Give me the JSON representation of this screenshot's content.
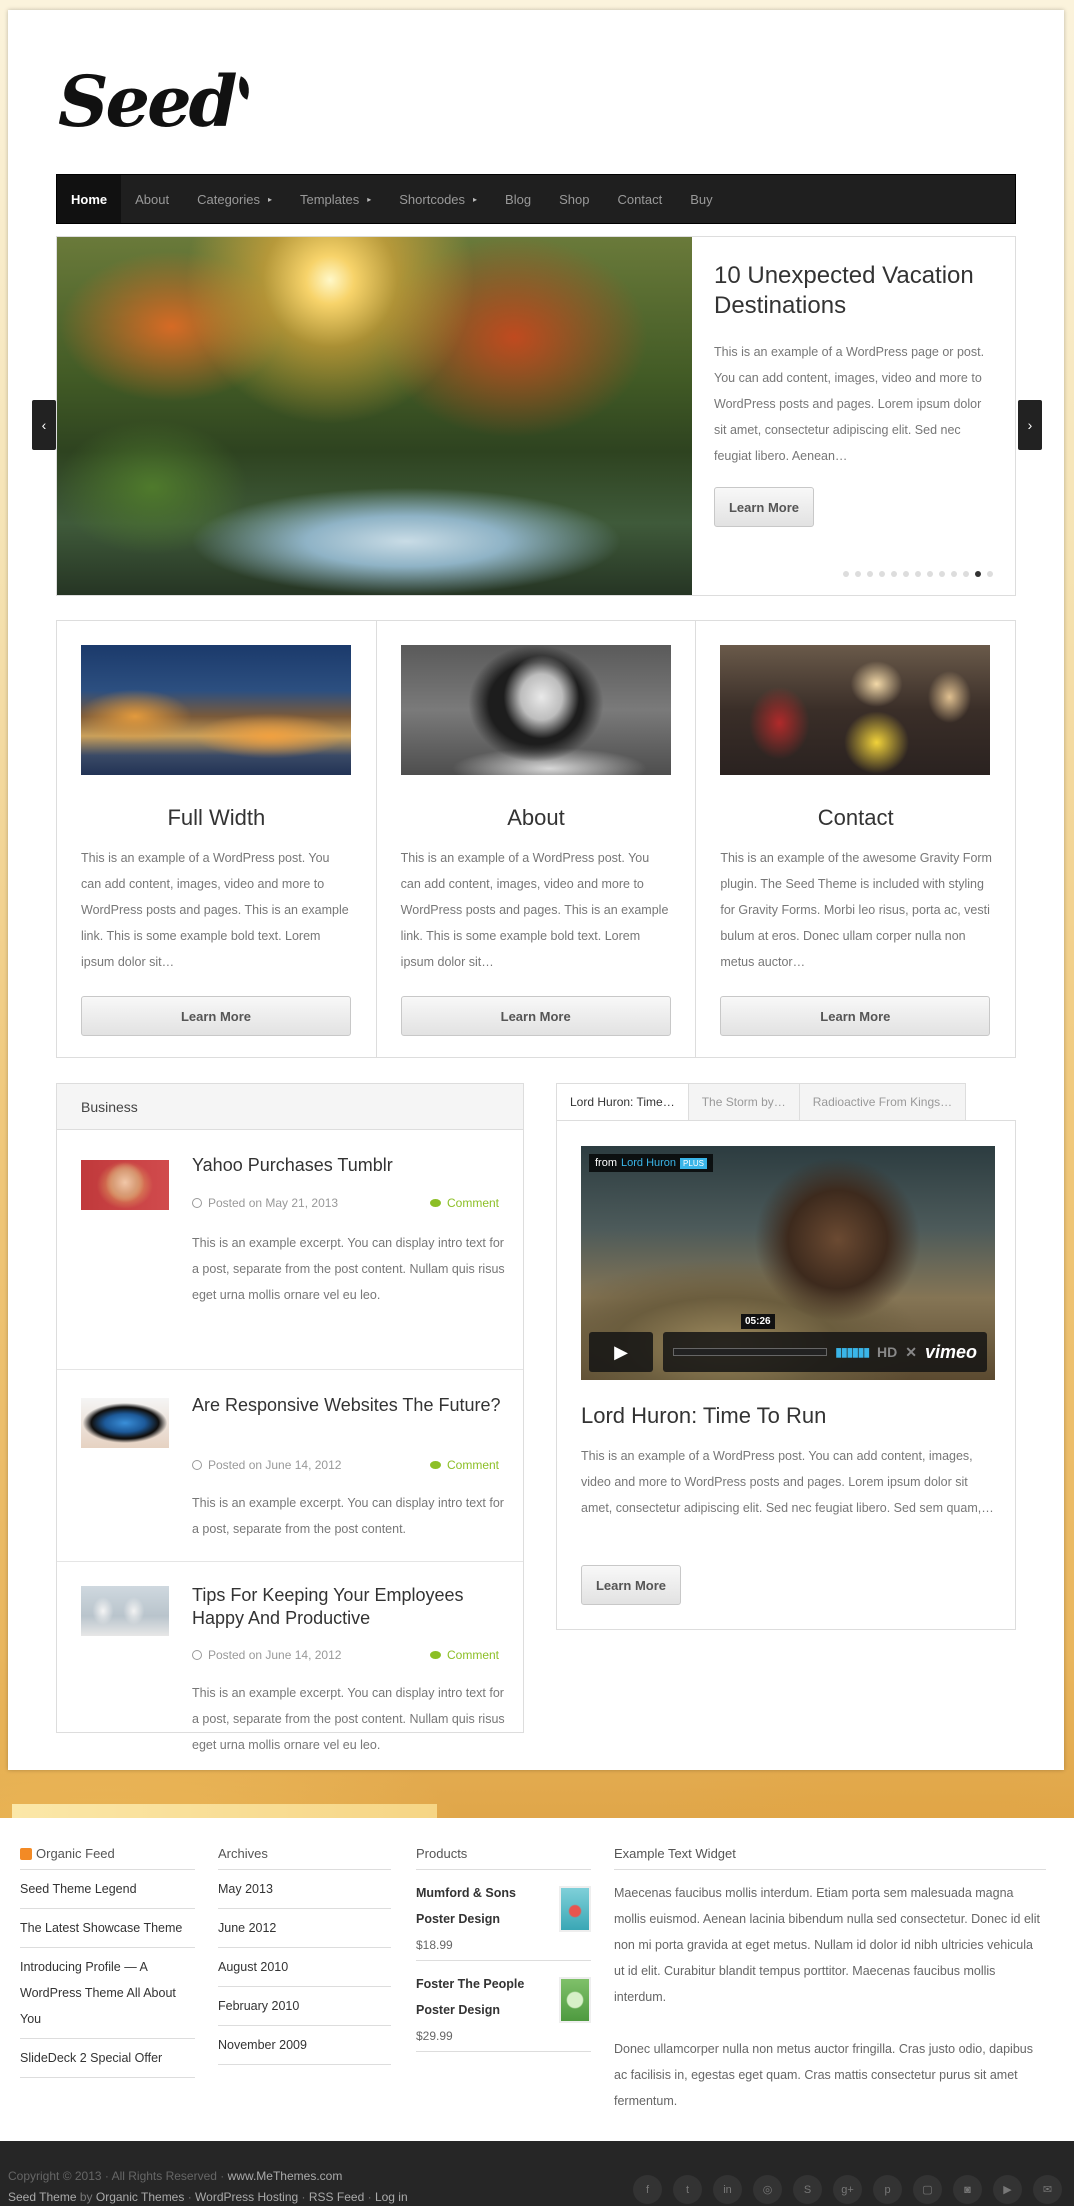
{
  "logo": {
    "text": "Seed"
  },
  "nav": {
    "items": [
      {
        "label": "Home",
        "caret": ""
      },
      {
        "label": "About",
        "caret": ""
      },
      {
        "label": "Categories",
        "caret": "▸"
      },
      {
        "label": "Templates",
        "caret": "▸"
      },
      {
        "label": "Shortcodes",
        "caret": "▸"
      },
      {
        "label": "Blog",
        "caret": ""
      },
      {
        "label": "Shop",
        "caret": ""
      },
      {
        "label": "Contact",
        "caret": ""
      },
      {
        "label": "Buy",
        "caret": ""
      }
    ]
  },
  "slider": {
    "title": "10 Unexpected Vacation Destinations",
    "text": "This is an example of a WordPress page or post. You can add content, images, video and more to WordPress posts and pages. Lorem ipsum dolor sit amet, consectetur adipiscing elit. Sed nec feugiat libero. Aenean…",
    "button": "Learn More",
    "prev": "‹",
    "next": "›",
    "dot_count": 13,
    "active_dot": 11
  },
  "features": [
    {
      "title": "Full Width",
      "text": "This is an example of a WordPress post. You can add content, images, video and more to WordPress posts and pages. This is an example link. This is some example bold text. Lorem ipsum dolor sit…",
      "button": "Learn More"
    },
    {
      "title": "About",
      "text": "This is an example of a WordPress post. You can add content, images, video and more to WordPress posts and pages. This is an example link. This is some example bold text. Lorem ipsum dolor sit…",
      "button": "Learn More"
    },
    {
      "title": "Contact",
      "text": "This is an example of the awesome Gravity Form plugin. The Seed Theme is included with styling for Gravity Forms. Morbi leo risus, porta ac, vesti bulum at eros. Donec ullam corper nulla non metus auctor…",
      "button": "Learn More"
    }
  ],
  "business": {
    "heading": "Business",
    "posts": [
      {
        "title": "Yahoo Purchases Tumblr",
        "date": "Posted on May 21, 2013",
        "comment": "Comment",
        "excerpt": "This is an example excerpt. You can display intro text for a post, separate from the post content. Nullam quis risus eget urna mollis ornare vel eu leo."
      },
      {
        "title": "Are Responsive Websites The Future?",
        "date": "Posted on June 14, 2012",
        "comment": "Comment",
        "excerpt": "This is an example excerpt. You can display intro text for a post, separate from the post content."
      },
      {
        "title": "Tips For Keeping Your Employees Happy And Productive",
        "date": "Posted on June 14, 2012",
        "comment": "Comment",
        "excerpt": "This is an example excerpt. You can display intro text for a post, separate from the post content. Nullam quis risus eget urna mollis ornare vel eu leo."
      }
    ]
  },
  "tabs": [
    "Lord Huron: Time…",
    "The Storm by…",
    "Radioactive From Kings…"
  ],
  "video": {
    "from_label": "from",
    "from_name": "Lord Huron",
    "plus": "PLUS",
    "time": "05:26",
    "hd": "HD",
    "brand": "vimeo",
    "title": "Lord Huron: Time To Run",
    "text": "This is an example of a WordPress post. You can add content, images, video and more to WordPress posts and pages. Lorem ipsum dolor sit amet, consectetur adipiscing elit. Sed nec feugiat libero. Sed sem quam,…",
    "button": "Learn More"
  },
  "footer": {
    "organic": {
      "heading": "Organic Feed",
      "items": [
        "Seed Theme Legend",
        "The Latest Showcase Theme",
        "Introducing Profile — A WordPress Theme All About You",
        "SlideDeck 2 Special Offer"
      ]
    },
    "archives": {
      "heading": "Archives",
      "items": [
        "May 2013",
        "June 2012",
        "August 2010",
        "February 2010",
        "November 2009"
      ]
    },
    "products": {
      "heading": "Products",
      "items": [
        {
          "name": "Mumford & Sons Poster Design",
          "price": "$18.99"
        },
        {
          "name": "Foster The People Poster Design",
          "price": "$29.99"
        }
      ]
    },
    "widget": {
      "heading": "Example Text Widget",
      "p1": "Maecenas faucibus mollis interdum. Etiam porta sem malesuada magna mollis euismod. Aenean lacinia bibendum nulla sed consectetur. Donec id elit non mi porta gravida at eget metus. Nullam id dolor id nibh ultricies vehicula ut id elit. Curabitur blandit tempus porttitor. Maecenas faucibus mollis interdum.",
      "p2": "Donec ullamcorper nulla non metus auctor fringilla. Cras justo odio, dapibus ac facilisis in, egestas eget quam. Cras mattis consectetur purus sit amet fermentum."
    }
  },
  "bottom": {
    "copyright": "Copyright © 2013 · All Rights Reserved ·",
    "site": "www.MeThemes.com",
    "line2_a": "Seed Theme",
    "line2_b": "by",
    "line2_c": "Organic Themes",
    "line2_d": "·",
    "line2_e": "WordPress Hosting",
    "line2_f": "·",
    "line2_g": "RSS Feed",
    "line2_h": "·",
    "line2_i": "Log in"
  },
  "social": [
    "f",
    "t",
    "in",
    "◎",
    "S",
    "g+",
    "p",
    "▢",
    "◙",
    "▶",
    "✉"
  ],
  "colors": {
    "accent": "#8cbf26",
    "nav_bg": "#1f1f1f",
    "vimeo_blue": "#3ab5e8"
  }
}
